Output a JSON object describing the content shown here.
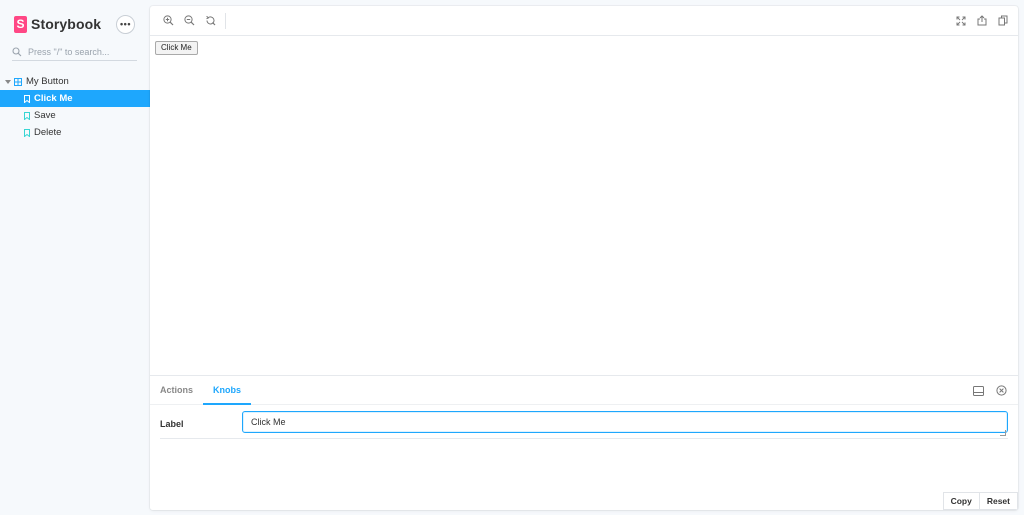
{
  "sidebar": {
    "brand": "Storybook",
    "brand_logo_letter": "S",
    "menu_button": "•••",
    "search_placeholder": "Press \"/\" to search...",
    "tree": {
      "component": "My Button",
      "stories": [
        {
          "label": "Click Me",
          "active": true
        },
        {
          "label": "Save",
          "active": false
        },
        {
          "label": "Delete",
          "active": false
        }
      ]
    }
  },
  "toolbar": {
    "left_icons": [
      "zoom-in-icon",
      "zoom-out-icon",
      "zoom-reset-icon"
    ],
    "right_icons": [
      "fullscreen-icon",
      "share-icon",
      "copy-link-icon"
    ]
  },
  "preview": {
    "button_label": "Click Me"
  },
  "addons": {
    "tabs": [
      {
        "label": "Actions",
        "active": false
      },
      {
        "label": "Knobs",
        "active": true
      }
    ],
    "knobs": [
      {
        "label": "Label",
        "value": "Click Me"
      }
    ],
    "footer": {
      "copy_label": "Copy",
      "reset_label": "Reset"
    }
  },
  "colors": {
    "accent": "#1ea7fd",
    "brand": "#ff4785",
    "sidebar_bg": "#f6f9fc"
  }
}
